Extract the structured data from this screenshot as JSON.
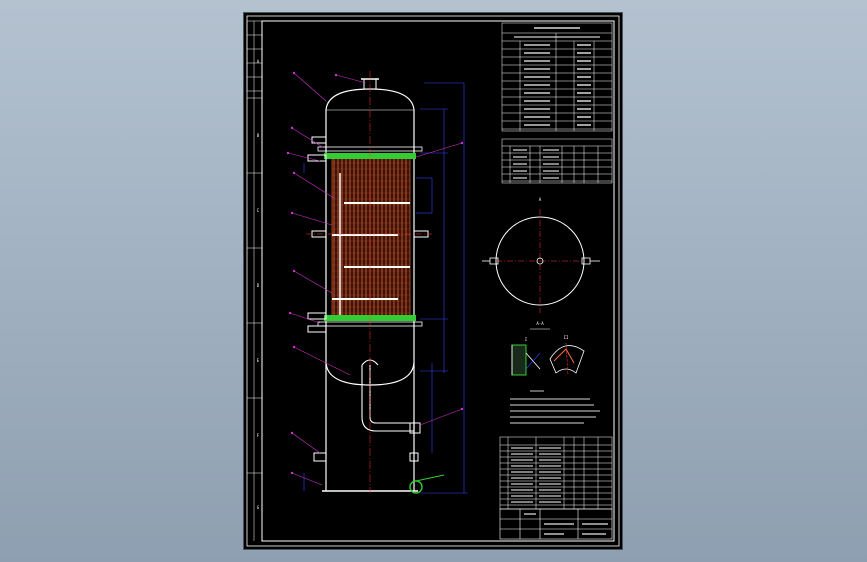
{
  "drawing": {
    "colors": {
      "background": "#000000",
      "frame": "#ffffff",
      "vessel": "#ffffff",
      "tube_bundle": "#ff6a3a",
      "tube_sheet": "#33cc33",
      "leader": "#cc33cc",
      "dimension": "#3344ff",
      "centerline": "#ff3333",
      "annotation": "#ffff66",
      "bottom_nozzle": "#33cc33"
    },
    "zone_letters_left": [
      "A",
      "B",
      "C",
      "D",
      "E",
      "F",
      "G"
    ],
    "section_view_top_label": "A",
    "section_view_bottom_label": "A-A",
    "detail_label": "I",
    "detail_label_2": "II"
  }
}
